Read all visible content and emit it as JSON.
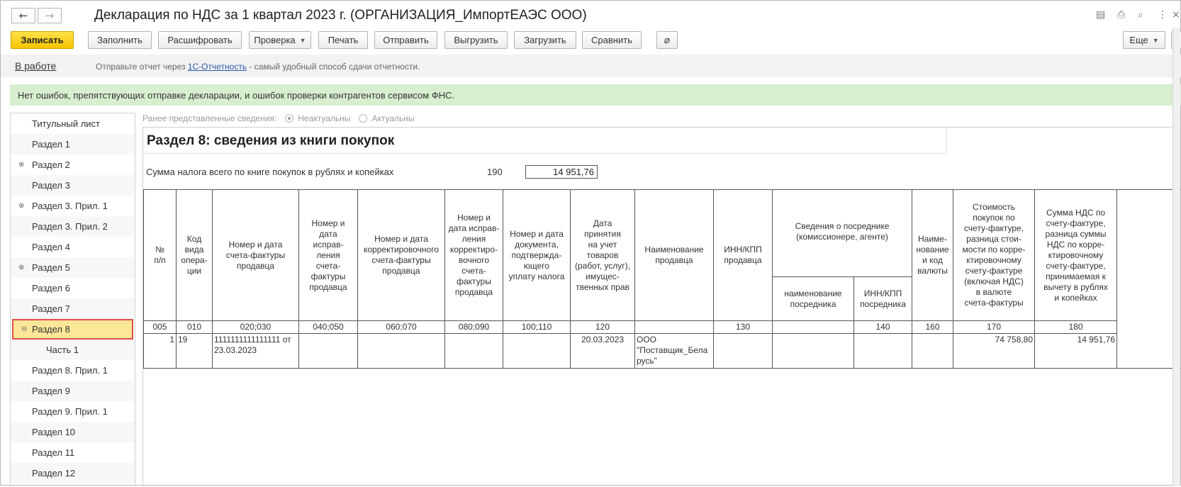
{
  "window": {
    "title": "Декларация по НДС за 1 квартал 2023 г. (ОРГАНИЗАЦИЯ_ИмпортЕАЭС ООО)",
    "back_glyph": "🡐",
    "forward_glyph": "🡒",
    "icons": [
      "save-icon",
      "print-icon",
      "preview-icon",
      "more-vertical-icon",
      "close-icon"
    ]
  },
  "toolbar": {
    "save": "Записать",
    "fill": "Заполнить",
    "decode": "Расшифровать",
    "check": "Проверка",
    "print": "Печать",
    "send": "Отправить",
    "export": "Выгрузить",
    "import": "Загрузить",
    "compare": "Сравнить",
    "more": "Еще",
    "colors": {
      "primary": "#f5c400"
    }
  },
  "info": {
    "status": "В работе",
    "text_before": "Отправьте отчет через ",
    "link": "1С-Отчетность",
    "text_after": " - самый удобный способ сдачи отчетности."
  },
  "check_result": "Нет ошибок, препятствующих отправке декларации, и ошибок проверки контрагентов сервисом ФНС.",
  "sidebar": {
    "items": [
      {
        "label": "Титульный лист",
        "expander": ""
      },
      {
        "label": "Раздел 1",
        "expander": ""
      },
      {
        "label": "Раздел 2",
        "expander": "⊕"
      },
      {
        "label": "Раздел 3",
        "expander": ""
      },
      {
        "label": "Раздел 3. Прил. 1",
        "expander": "⊕"
      },
      {
        "label": "Раздел 3. Прил. 2",
        "expander": ""
      },
      {
        "label": "Раздел 4",
        "expander": ""
      },
      {
        "label": "Раздел 5",
        "expander": "⊕"
      },
      {
        "label": "Раздел 6",
        "expander": ""
      },
      {
        "label": "Раздел 7",
        "expander": ""
      },
      {
        "label": "Раздел 8",
        "expander": "⊖"
      },
      {
        "label": "Часть 1",
        "expander": ""
      },
      {
        "label": "Раздел 8. Прил. 1",
        "expander": ""
      },
      {
        "label": "Раздел 9",
        "expander": ""
      },
      {
        "label": "Раздел 9. Прил. 1",
        "expander": ""
      },
      {
        "label": "Раздел 10",
        "expander": ""
      },
      {
        "label": "Раздел 11",
        "expander": ""
      },
      {
        "label": "Раздел 12",
        "expander": ""
      }
    ],
    "selected": "Раздел 8"
  },
  "earlier_info": {
    "label": "Ранее представленные сведения:",
    "option_irrelevant": "Неактуальны",
    "option_relevant": "Актуальны",
    "selected": "Неактуальны"
  },
  "report": {
    "section_title": "Раздел 8: сведения из книги покупок",
    "sum_label": "Сумма налога всего по книге покупок в рублях и копейках",
    "sum_code": "190",
    "sum_value": "14 951,76",
    "headers": {
      "num": "№\nп/п",
      "op_code": "Код\nвида\nопера-\nции",
      "invoice": "Номер и дата\nсчета-фактуры\nпродавца",
      "corr_invoice_num": "Номер и\nдата\nисправ-\nления\nсчета-\nфактуры\nпродавца",
      "adj_invoice": "Номер и дата\nкорректировочного\nсчета-фактуры\nпродавца",
      "adj_corr": "Номер и\nдата исправ-\nления\nкорректиро-\nвочного\nсчета-\nфактуры\nпродавца",
      "payment_doc": "Номер и дата\nдокумента,\nподтвержда-\nющего\nуплату налога",
      "accept_date": "Дата\nпринятия\nна учет\nтоваров\n(работ, услуг),\nимущес-\nтвенных прав",
      "seller_name": "Наименование\nпродавца",
      "seller_inn": "ИНН/КПП\nпродавца",
      "agent": "Сведения о посреднике\n(комиссионере, агенте)",
      "agent_name": "наименование\nпосредника",
      "agent_inn": "ИНН/КПП\nпосредника",
      "currency": "Наиме-\nнование\nи код\nвалюты",
      "cost": "Стоимость\nпокупок по\nсчету-фактуре,\nразница стои-\nмости по корре-\nктировочному\nсчету-фактуре\n(включая НДС)\nв валюте\nсчета-фактуры",
      "vat": "Сумма НДС по\nсчету-фактуре,\nразница суммы\nНДС по корре-\nктировочному\nсчету-фактуре,\nпринимаемая к\nвычету в рублях\nи копейках"
    },
    "codes": [
      "005",
      "010",
      "020;030",
      "040;050",
      "060;070",
      "080;090",
      "100;110",
      "120",
      "",
      "130",
      "",
      "140",
      "160",
      "170",
      "180"
    ],
    "row": {
      "num": "1",
      "op_code": "19",
      "invoice": "1111111111111111 от\n23.03.2023",
      "accept_date": "20.03.2023",
      "seller_name": "ООО\n\"Поставщик_Бела\nрусь\"",
      "cost": "74 758,80",
      "vat": "14 951,76"
    }
  }
}
